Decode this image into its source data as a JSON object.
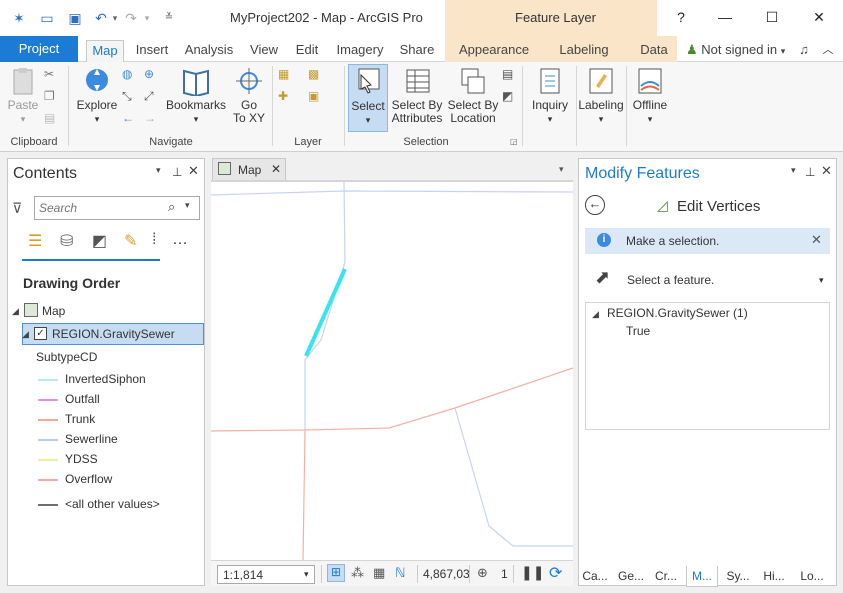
{
  "window": {
    "title": "MyProject202 - Map - ArcGIS Pro",
    "context_group": "Feature Layer",
    "help": "?",
    "signed_in": "Not signed in"
  },
  "tabs": [
    {
      "label": "Project"
    },
    {
      "label": "Map"
    },
    {
      "label": "Insert"
    },
    {
      "label": "Analysis"
    },
    {
      "label": "View"
    },
    {
      "label": "Edit"
    },
    {
      "label": "Imagery"
    },
    {
      "label": "Share"
    },
    {
      "label": "Appearance"
    },
    {
      "label": "Labeling"
    },
    {
      "label": "Data"
    }
  ],
  "ribbon": {
    "paste": "Paste",
    "explore": "Explore",
    "bookmarks": "Bookmarks",
    "goto_1": "Go",
    "goto_2": "To XY",
    "select": "Select",
    "select_attr_1": "Select By",
    "select_attr_2": "Attributes",
    "select_loc_1": "Select By",
    "select_loc_2": "Location",
    "inquiry": "Inquiry",
    "labeling": "Labeling",
    "offline": "Offline",
    "groups": {
      "clipboard": "Clipboard",
      "navigate": "Navigate",
      "layer": "Layer",
      "selection": "Selection"
    }
  },
  "contents": {
    "title": "Contents",
    "search_placeholder": "Search",
    "drawing_order": "Drawing Order",
    "map_name": "Map",
    "layer_name": "REGION.GravitySewer",
    "field": "SubtypeCD",
    "legend": [
      {
        "label": "InvertedSiphon",
        "color": "#b7ecd8"
      },
      {
        "label": "Outfall",
        "color": "#e98ee6"
      },
      {
        "label": "Trunk",
        "color": "#f3a89a"
      },
      {
        "label": "Sewerline",
        "color": "#b8c9f2"
      },
      {
        "label": "YDSS",
        "color": "#ecf09a"
      },
      {
        "label": "Overflow",
        "color": "#f5a6a6"
      },
      {
        "label": "<all other values>",
        "color": "#6e6e6e"
      }
    ]
  },
  "map_view": {
    "tab_label": "Map",
    "scale": "1:1,814",
    "coords": "4,867,03",
    "selected_count": "1",
    "colors": {
      "selected": "#33e6f2",
      "sewer": "#b8c9f2",
      "trunk": "#f3a89a"
    }
  },
  "modify": {
    "title": "Modify Features",
    "tool": "Edit Vertices",
    "info": "Make a selection.",
    "select_prompt": "Select a feature.",
    "tree_layer": "REGION.GravitySewer (1)",
    "tree_value": "True"
  },
  "bottom_tabs": [
    {
      "label": "Ca..."
    },
    {
      "label": "Ge..."
    },
    {
      "label": "Cr..."
    },
    {
      "label": "M..."
    },
    {
      "label": "Sy..."
    },
    {
      "label": "Hi..."
    },
    {
      "label": "Lo..."
    }
  ]
}
